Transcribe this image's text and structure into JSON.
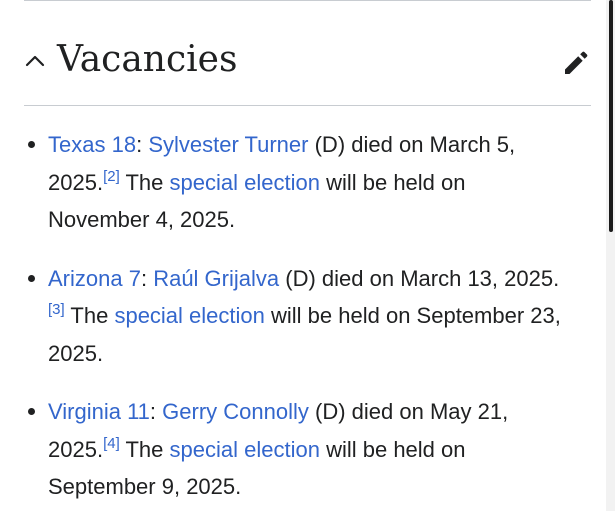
{
  "section": {
    "title": "Vacancies",
    "collapse_icon": "chevron-up-icon",
    "edit_icon": "pencil-icon"
  },
  "colors": {
    "link": "#3366cc",
    "text": "#202122",
    "rule": "#c8ccd1"
  },
  "vacancies": [
    {
      "district": "Texas 18",
      "separator": ":",
      "member": "Sylvester Turner",
      "party_died": "(D) died on March 5, 2025.",
      "ref": "[2]",
      "the": "The",
      "special": "special election",
      "held_on": "will be held on November 4, 2025."
    },
    {
      "district": "Arizona 7",
      "separator": ":",
      "member": "Raúl Grijalva",
      "party_died": "(D) died on March 13, 2025.",
      "ref": "[3]",
      "the": "The",
      "special": "special election",
      "held_on": "will be held on September 23, 2025."
    },
    {
      "district": "Virginia 11",
      "separator": ":",
      "member": "Gerry Connolly",
      "party_died": "(D) died on May 21, 2025.",
      "ref": "[4]",
      "the": "The",
      "special": "special election",
      "held_on": "will be held on September 9, 2025."
    }
  ]
}
